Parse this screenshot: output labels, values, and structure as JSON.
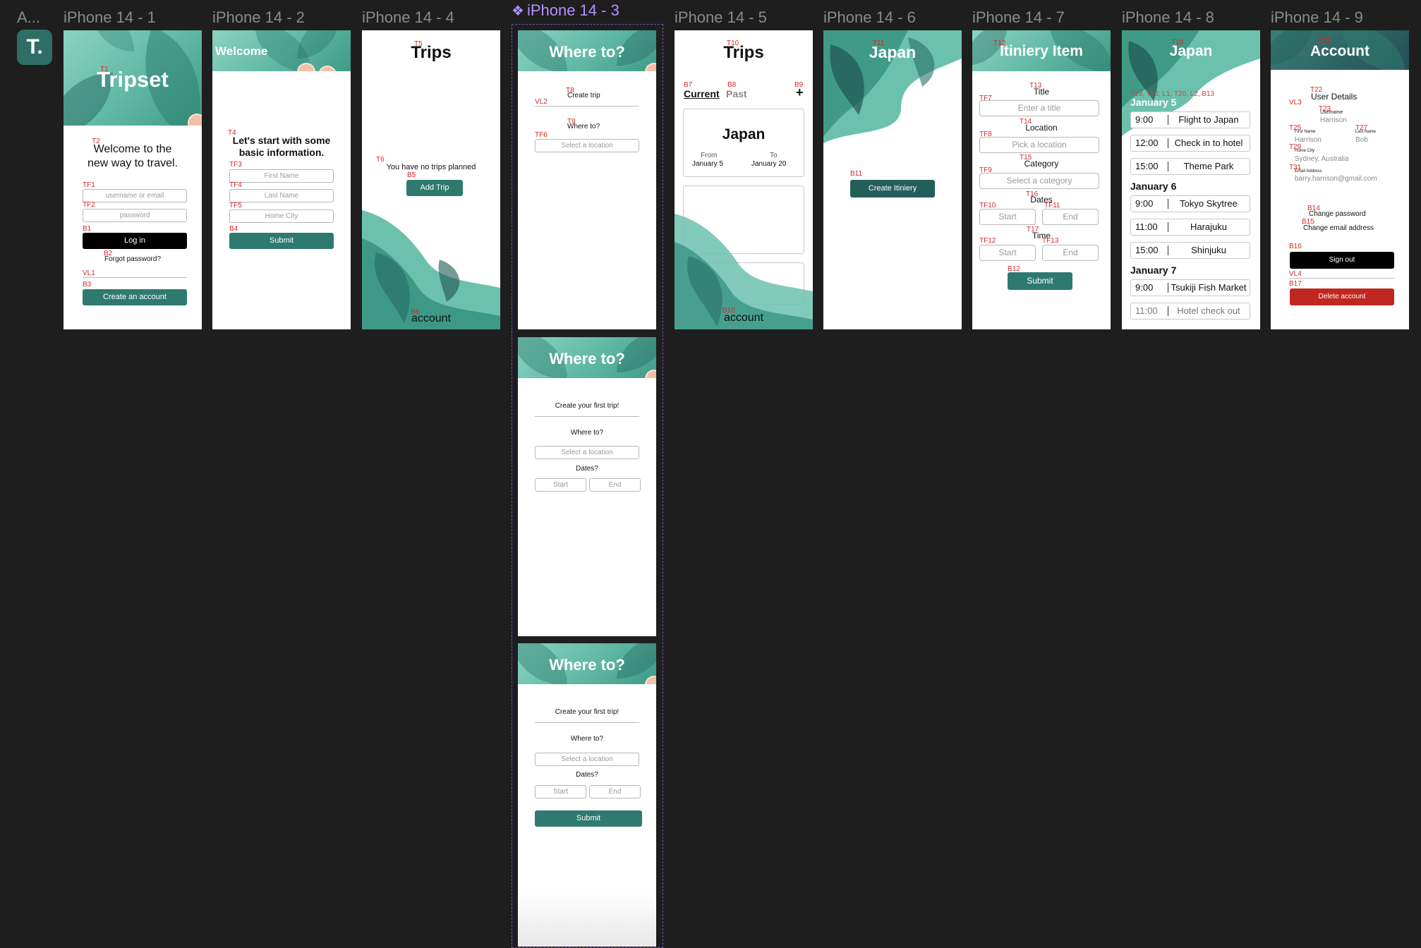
{
  "canvas": {
    "background": "#1e1e1e",
    "accent": "#2f7a70",
    "danger": "#c0271f"
  },
  "app_label": "A...",
  "app_logo": {
    "letter": "T.",
    "color": "#2e6e66"
  },
  "frames": {
    "f1": {
      "label": "iPhone 14 - 1",
      "title": "Tripset",
      "annot_title": "T1",
      "welcome_line1": "Welcome to the",
      "welcome_line2": "new way to travel.",
      "annot_welcome": "T2",
      "username_placeholder": "username or email",
      "annot_username": "TF1",
      "password_placeholder": "password",
      "annot_password": "TF2",
      "login_label": "Log in",
      "annot_login": "B1",
      "forgot_label": "Forgot password?",
      "annot_forgot": "B2",
      "annot_line": "VL1",
      "create_label": "Create an account",
      "annot_create": "B3"
    },
    "f2": {
      "label": "iPhone 14 - 2",
      "title": "Welcome",
      "annot_title": "T3",
      "heading_line1": "Let's start with some",
      "heading_line2": "basic information.",
      "annot_heading": "T4",
      "first_name": "First Name",
      "annot_first": "TF3",
      "last_name": "Last Name",
      "annot_last": "TF4",
      "home_city": "Home City",
      "annot_city": "TF5",
      "submit_label": "Submit",
      "annot_submit": "B4"
    },
    "f4": {
      "label": "iPhone 14 - 4",
      "title": "Trips",
      "annot_title": "T5",
      "empty_text": "You have no trips planned",
      "annot_empty": "T6",
      "add_label": "Add Trip",
      "annot_add": "B5",
      "account_label": "account",
      "annot_account": "B6"
    },
    "f3": {
      "label": "iPhone 14 - 3",
      "title": "Where to?",
      "annot_title": "T7",
      "a_create": "Create trip",
      "annot_create": "T8",
      "annot_line": "VL2",
      "a_where": "Where to?",
      "annot_where": "T9",
      "a_location": "Select a location",
      "annot_location": "TF6",
      "b_title": "Where to?",
      "b_create": "Create your first trip!",
      "b_where": "Where to?",
      "b_location": "Select a location",
      "b_dates": "Dates?",
      "b_start": "Start",
      "b_end": "End",
      "c_title": "Where to?",
      "c_create": "Create your first trip!",
      "c_where": "Where to?",
      "c_location": "Select a location",
      "c_dates": "Dates?",
      "c_start": "Start",
      "c_end": "End",
      "c_submit": "Submit"
    },
    "f5": {
      "label": "iPhone 14 - 5",
      "title": "Trips",
      "annot_title": "T10",
      "tab_current": "Current",
      "annot_current": "B7",
      "tab_past": "Past",
      "annot_past": "B8",
      "add_symbol": "+",
      "annot_add": "B9",
      "trip_name": "Japan",
      "from_label": "From",
      "from_date": "January 5",
      "to_label": "To",
      "to_date": "January 20",
      "account_label": "account",
      "annot_account": "B10"
    },
    "f6": {
      "label": "iPhone 14 - 6",
      "title": "Japan",
      "annot_title": "T11",
      "create_label": "Create Itiniery",
      "annot_create": "B11"
    },
    "f7": {
      "label": "iPhone 14 - 7",
      "title": "Itiniery Item",
      "annot_title": "T12",
      "title_label": "Title",
      "annot_title_label": "T13",
      "title_placeholder": "Enter a title",
      "annot_title_field": "TF7",
      "location_label": "Location",
      "annot_location_label": "T14",
      "location_placeholder": "Pick a location",
      "annot_location_field": "TF8",
      "category_label": "Category",
      "annot_category_label": "T15",
      "category_placeholder": "Select a category",
      "annot_category_field": "TF9",
      "dates_label": "Dates",
      "annot_dates": "T16",
      "dates_start": "Start",
      "annot_dstart": "TF10",
      "dates_end": "End",
      "annot_dend": "TF11",
      "time_label": "Time",
      "annot_time": "T17",
      "time_start": "Start",
      "annot_tstart": "TF12",
      "time_end": "End",
      "annot_tend": "TF13",
      "submit_label": "Submit",
      "annot_submit": "B12"
    },
    "f8": {
      "label": "iPhone 14 - 8",
      "title": "Japan",
      "annot_title": "T18",
      "annot_list": "T19, T20, L1, T20, L2, B13",
      "days": [
        {
          "label": "January 5",
          "items": [
            {
              "time": "9:00",
              "name": "Flight to Japan"
            },
            {
              "time": "12:00",
              "name": "Check in to hotel"
            },
            {
              "time": "15:00",
              "name": "Theme Park"
            }
          ]
        },
        {
          "label": "January 6",
          "items": [
            {
              "time": "9:00",
              "name": "Tokyo Skytree"
            },
            {
              "time": "11:00",
              "name": "Harajuku"
            },
            {
              "time": "15:00",
              "name": "Shinjuku"
            }
          ]
        },
        {
          "label": "January 7",
          "items": [
            {
              "time": "9:00",
              "name": "Tsukiji Fish Market"
            },
            {
              "time": "11:00",
              "name": "Hotel check out"
            }
          ]
        }
      ]
    },
    "f9": {
      "label": "iPhone 14 - 9",
      "title": "Account",
      "annot_title": "T21",
      "annot_line3": "VL3",
      "details": "User Details",
      "annot_details": "T22",
      "username_label": "Username",
      "username_value": "Harrison",
      "annot_username": "T23",
      "first_label": "First Name",
      "first_value": "Harrison",
      "annot_first": "T25",
      "last_label": "Last Name",
      "last_value": "Bob",
      "annot_last": "T27",
      "city_label": "Home City",
      "city_value": "Sydney, Australia",
      "annot_city": "T29",
      "email_label": "Email Address",
      "email_value": "barry.harrison@gmail.com",
      "annot_email": "T31",
      "change_password": "Change password",
      "annot_password": "B14",
      "change_email": "Change email address",
      "annot_email_btn": "B15",
      "sign_out": "Sign out",
      "annot_signout": "B16",
      "annot_line4": "VL4",
      "delete_account": "Delete account",
      "annot_delete": "B17"
    }
  }
}
